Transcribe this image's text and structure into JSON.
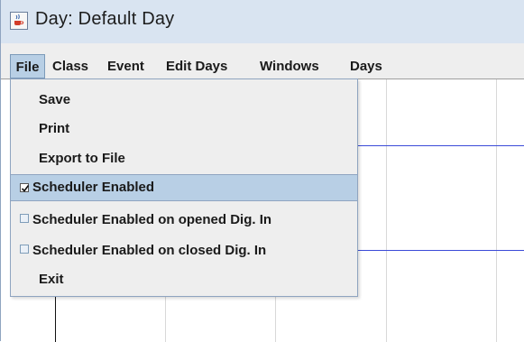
{
  "window": {
    "title": "Day: Default Day",
    "icon": "java-cup-icon"
  },
  "menubar": {
    "items": [
      {
        "label": "File",
        "active": true
      },
      {
        "label": "Class"
      },
      {
        "label": "Event"
      },
      {
        "label": "Edit Days"
      },
      {
        "label": "Windows"
      },
      {
        "label": "Days"
      }
    ]
  },
  "file_menu": {
    "items": [
      {
        "label": "Save",
        "type": "action"
      },
      {
        "label": "Print",
        "type": "action"
      },
      {
        "label": "Export to File",
        "type": "action"
      },
      {
        "label": "Scheduler Enabled",
        "type": "checkbox",
        "checked": true,
        "highlighted": true
      },
      {
        "label": "Scheduler Enabled on opened Dig. In",
        "type": "checkbox",
        "checked": false
      },
      {
        "label": "Scheduler Enabled on closed Dig. In",
        "type": "checkbox",
        "checked": false
      },
      {
        "label": "Exit",
        "type": "action"
      }
    ]
  },
  "colors": {
    "accent_highlight": "#b8cfe5",
    "schedule_line": "#3b4bd8",
    "titlebar": "#d9e4f1"
  }
}
